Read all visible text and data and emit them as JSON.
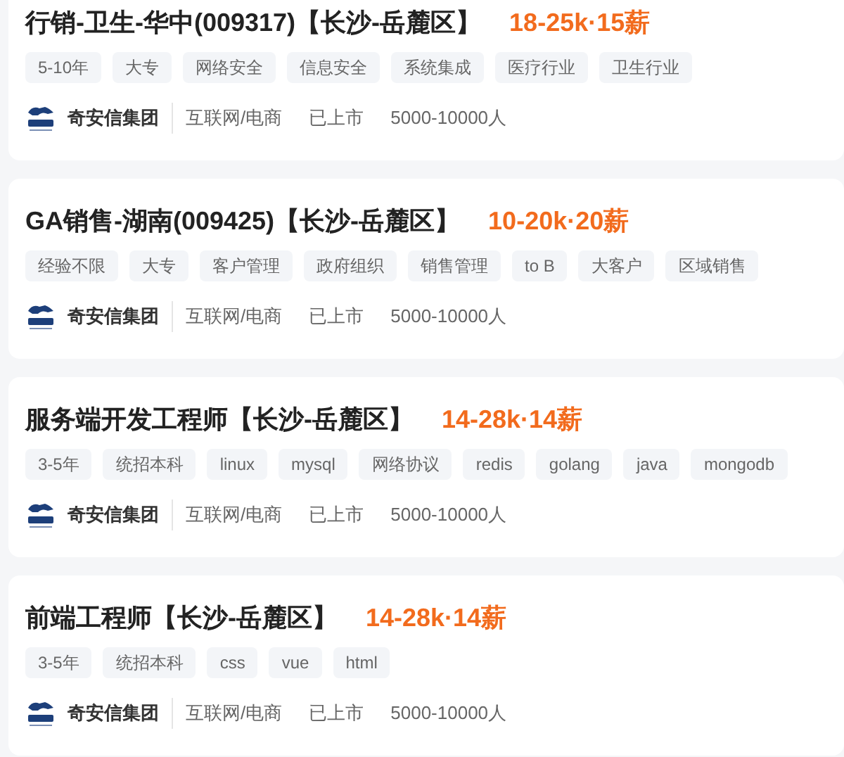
{
  "jobs": [
    {
      "title": "行销-卫生-华中(009317)【长沙-岳麓区】",
      "salary": "18-25k·15薪",
      "tags": [
        "5-10年",
        "大专",
        "网络安全",
        "信息安全",
        "系统集成",
        "医疗行业",
        "卫生行业"
      ],
      "company": {
        "name": "奇安信集团",
        "industry": "互联网/电商",
        "stage": "已上市",
        "size": "5000-10000人"
      }
    },
    {
      "title": "GA销售-湖南(009425)【长沙-岳麓区】",
      "salary": "10-20k·20薪",
      "tags": [
        "经验不限",
        "大专",
        "客户管理",
        "政府组织",
        "销售管理",
        "to B",
        "大客户",
        "区域销售"
      ],
      "company": {
        "name": "奇安信集团",
        "industry": "互联网/电商",
        "stage": "已上市",
        "size": "5000-10000人"
      }
    },
    {
      "title": "服务端开发工程师【长沙-岳麓区】",
      "salary": "14-28k·14薪",
      "tags": [
        "3-5年",
        "统招本科",
        "linux",
        "mysql",
        "网络协议",
        "redis",
        "golang",
        "java",
        "mongodb"
      ],
      "company": {
        "name": "奇安信集团",
        "industry": "互联网/电商",
        "stage": "已上市",
        "size": "5000-10000人"
      }
    },
    {
      "title": "前端工程师【长沙-岳麓区】",
      "salary": "14-28k·14薪",
      "tags": [
        "3-5年",
        "统招本科",
        "css",
        "vue",
        "html"
      ],
      "company": {
        "name": "奇安信集团",
        "industry": "互联网/电商",
        "stage": "已上市",
        "size": "5000-10000人"
      }
    }
  ]
}
